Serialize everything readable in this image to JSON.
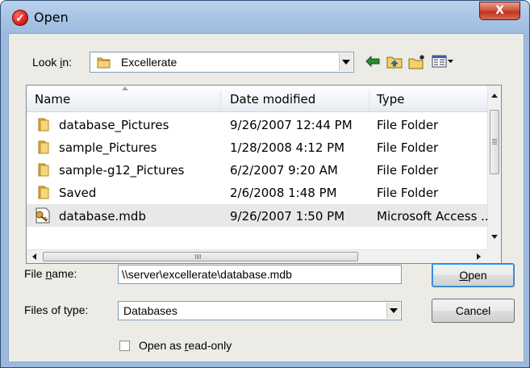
{
  "window": {
    "title": "Open",
    "close_label": "X"
  },
  "look_in": {
    "label_before": "Look ",
    "label_access_key": "i",
    "label_after": "n:",
    "value": "Excellerate"
  },
  "toolbar": {
    "icons": [
      "back-arrow-icon",
      "up-one-level-icon",
      "new-folder-icon",
      "view-menu-icon"
    ]
  },
  "file_list": {
    "columns": [
      "Name",
      "Date modified",
      "Type"
    ],
    "rows": [
      {
        "name": "database_Pictures",
        "date": "9/26/2007 12:44 PM",
        "type": "File Folder",
        "icon": "folder-icon"
      },
      {
        "name": "sample_Pictures",
        "date": "1/28/2008 4:12 PM",
        "type": "File Folder",
        "icon": "folder-icon"
      },
      {
        "name": "sample-g12_Pictures",
        "date": "6/2/2007 9:20 AM",
        "type": "File Folder",
        "icon": "folder-icon"
      },
      {
        "name": "Saved",
        "date": "2/6/2008 1:48 PM",
        "type": "File Folder",
        "icon": "folder-icon"
      },
      {
        "name": "database.mdb",
        "date": "9/26/2007 1:50 PM",
        "type": "Microsoft Access ...",
        "icon": "access-database-icon",
        "selected": true
      }
    ]
  },
  "file_name": {
    "label_before": "File ",
    "label_access_key": "n",
    "label_after": "ame:",
    "value": "\\\\server\\excellerate\\database.mdb"
  },
  "file_type": {
    "label": "Files of type:",
    "value": "Databases"
  },
  "buttons": {
    "open_access_key": "O",
    "open_rest": "pen",
    "cancel": "Cancel"
  },
  "read_only": {
    "label_before": "Open as ",
    "label_access_key": "r",
    "label_after": "ead-only",
    "checked": false
  }
}
